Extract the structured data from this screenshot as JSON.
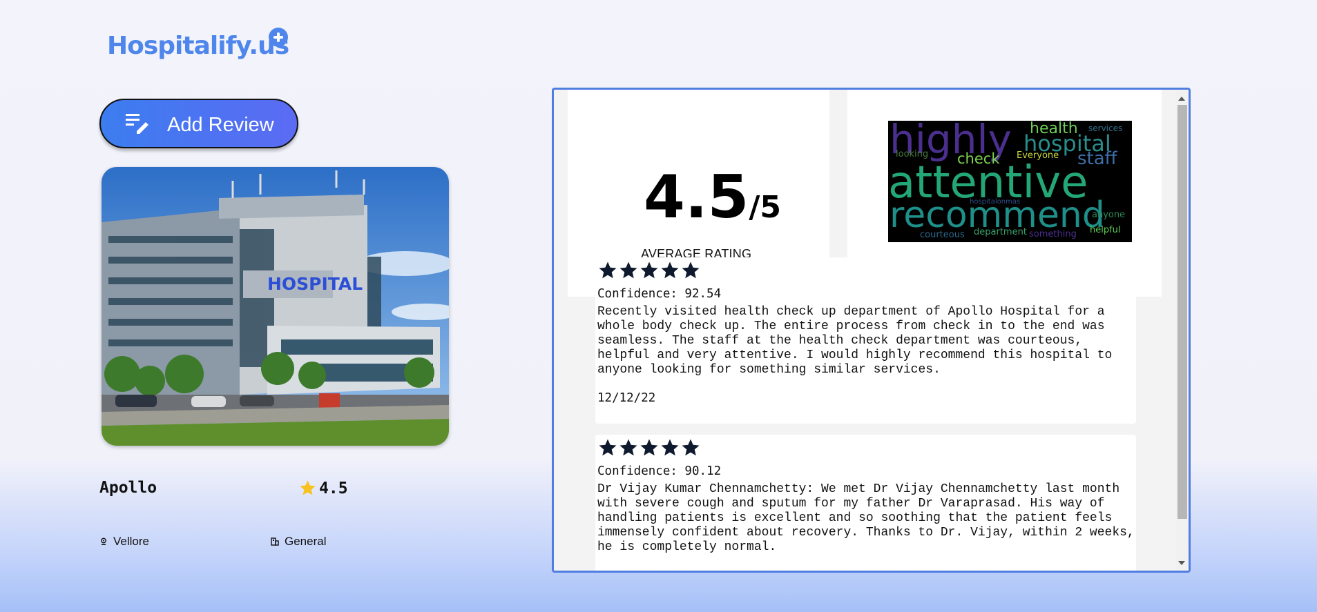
{
  "brand": {
    "name": "Hospitalify.us",
    "logo_icon": "plus-circle-icon",
    "accent": "#4f86ec"
  },
  "actions": {
    "add_review_label": "Add Review",
    "add_review_icon": "edit-list-icon"
  },
  "hospital": {
    "image_sign": "HOSPITAL",
    "name": "Apollo",
    "rating": "4.5",
    "location": "Vellore",
    "type": "General"
  },
  "summary": {
    "rating": "4.5",
    "out_of": "/5",
    "label": "AVERAGE RATING"
  },
  "wordcloud": {
    "words": [
      "highly",
      "health",
      "services",
      "hospital",
      "looking",
      "check",
      "Everyone",
      "staff",
      "attentive",
      "recommend",
      "hospitalonmas",
      "anyone",
      "helpful",
      "courteous",
      "department",
      "something"
    ]
  },
  "reviews": [
    {
      "stars": 5,
      "confidence": "Confidence: 92.54",
      "text": "Recently visited health check up department of Apollo Hospital for a whole body check up. The entire process from check in to the end was seamless. The staff at the health check department was courteous, helpful and very attentive. I would highly recommend this hospital to anyone looking for something similar services.",
      "date": "12/12/22"
    },
    {
      "stars": 5,
      "confidence": "Confidence: 90.12",
      "text": "Dr Vijay Kumar Chennamchetty: We met Dr Vijay Chennamchetty last month with severe cough and sputum for my father Dr Varaprasad. His way of handling patients is excellent and so soothing that the patient feels immensely confident about recovery. Thanks to Dr. Vijay, within 2 weeks, he is completely normal."
    }
  ]
}
